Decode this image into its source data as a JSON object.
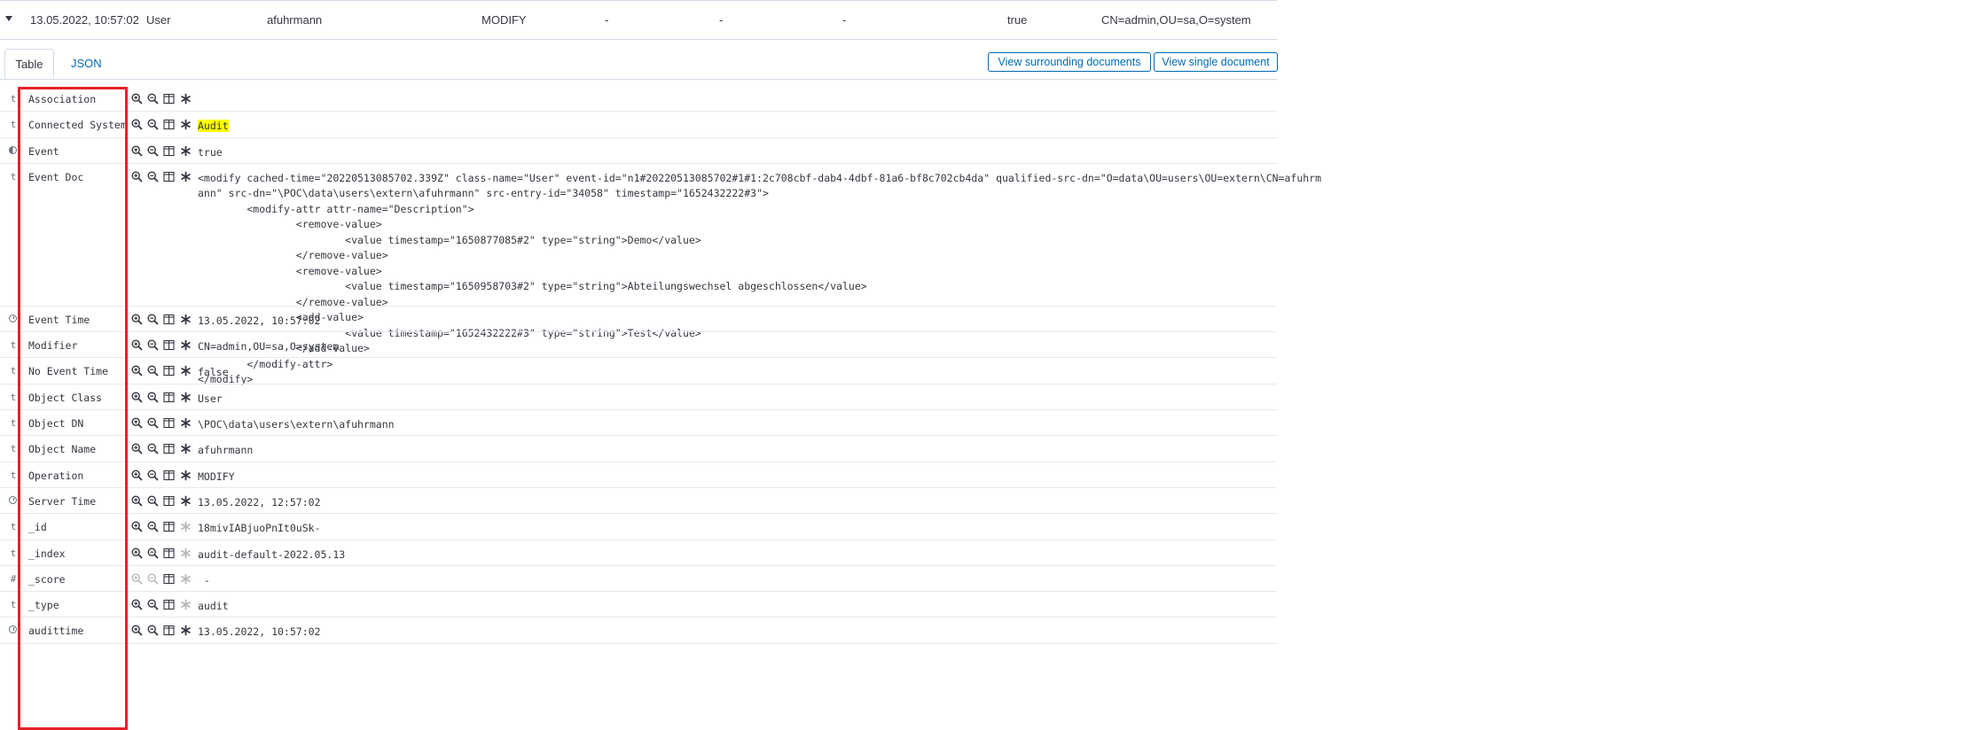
{
  "summary": {
    "time": "13.05.2022, 10:57:02",
    "object_class": "User",
    "object_name": "afuhrmann",
    "operation": "MODIFY",
    "dash1": "-",
    "dash2": "-",
    "dash3": "-",
    "event": "true",
    "modifier": "CN=admin,OU=sa,O=system"
  },
  "tabs": {
    "table": "Table",
    "json": "JSON"
  },
  "buttons": {
    "surrounding": "View surrounding documents",
    "single": "View single document"
  },
  "fields": [
    {
      "type": "t",
      "name": "Association",
      "value": ""
    },
    {
      "type": "t",
      "name": "Connected System",
      "value": "Audit"
    },
    {
      "type": "bool",
      "name": "Event",
      "value": "true"
    },
    {
      "type": "t",
      "name": "Event Doc",
      "value": "<modify cached-time=\"20220513085702.339Z\" class-name=\"User\" event-id=\"n1#20220513085702#1#1:2c708cbf-dab4-4dbf-81a6-bf8c702cb4da\" qualified-src-dn=\"O=data\\OU=users\\OU=extern\\CN=afuhrm\nann\" src-dn=\"\\POC\\data\\users\\extern\\afuhrmann\" src-entry-id=\"34058\" timestamp=\"1652432222#3\">\n        <modify-attr attr-name=\"Description\">\n                <remove-value>\n                        <value timestamp=\"1650877085#2\" type=\"string\">Demo</value>\n                </remove-value>\n                <remove-value>\n                        <value timestamp=\"1650958703#2\" type=\"string\">Abteilungswechsel abgeschlossen</value>\n                </remove-value>\n                <add-value>\n                        <value timestamp=\"1652432222#3\" type=\"string\">Test</value>\n                </add-value>\n        </modify-attr>\n</modify>"
    },
    {
      "type": "clock",
      "name": "Event Time",
      "value": "13.05.2022, 10:57:02"
    },
    {
      "type": "t",
      "name": "Modifier",
      "value": "CN=admin,OU=sa,O=system"
    },
    {
      "type": "t",
      "name": "No Event Time",
      "value": "false"
    },
    {
      "type": "t",
      "name": "Object Class",
      "value": "User"
    },
    {
      "type": "t",
      "name": "Object DN",
      "value": "\\POC\\data\\users\\extern\\afuhrmann"
    },
    {
      "type": "t",
      "name": "Object Name",
      "value": "afuhrmann"
    },
    {
      "type": "t",
      "name": "Operation",
      "value": "MODIFY"
    },
    {
      "type": "clock",
      "name": "Server Time",
      "value": "13.05.2022, 12:57:02"
    },
    {
      "type": "t",
      "name": "_id",
      "value": "18mivIABjuoPnIt0uSk-"
    },
    {
      "type": "t",
      "name": "_index",
      "value": "audit-default-2022.05.13"
    },
    {
      "type": "#",
      "name": "_score",
      "value": " -"
    },
    {
      "type": "t",
      "name": "_type",
      "value": "audit"
    },
    {
      "type": "clock",
      "name": "audittime",
      "value": "13.05.2022, 10:57:02"
    }
  ]
}
